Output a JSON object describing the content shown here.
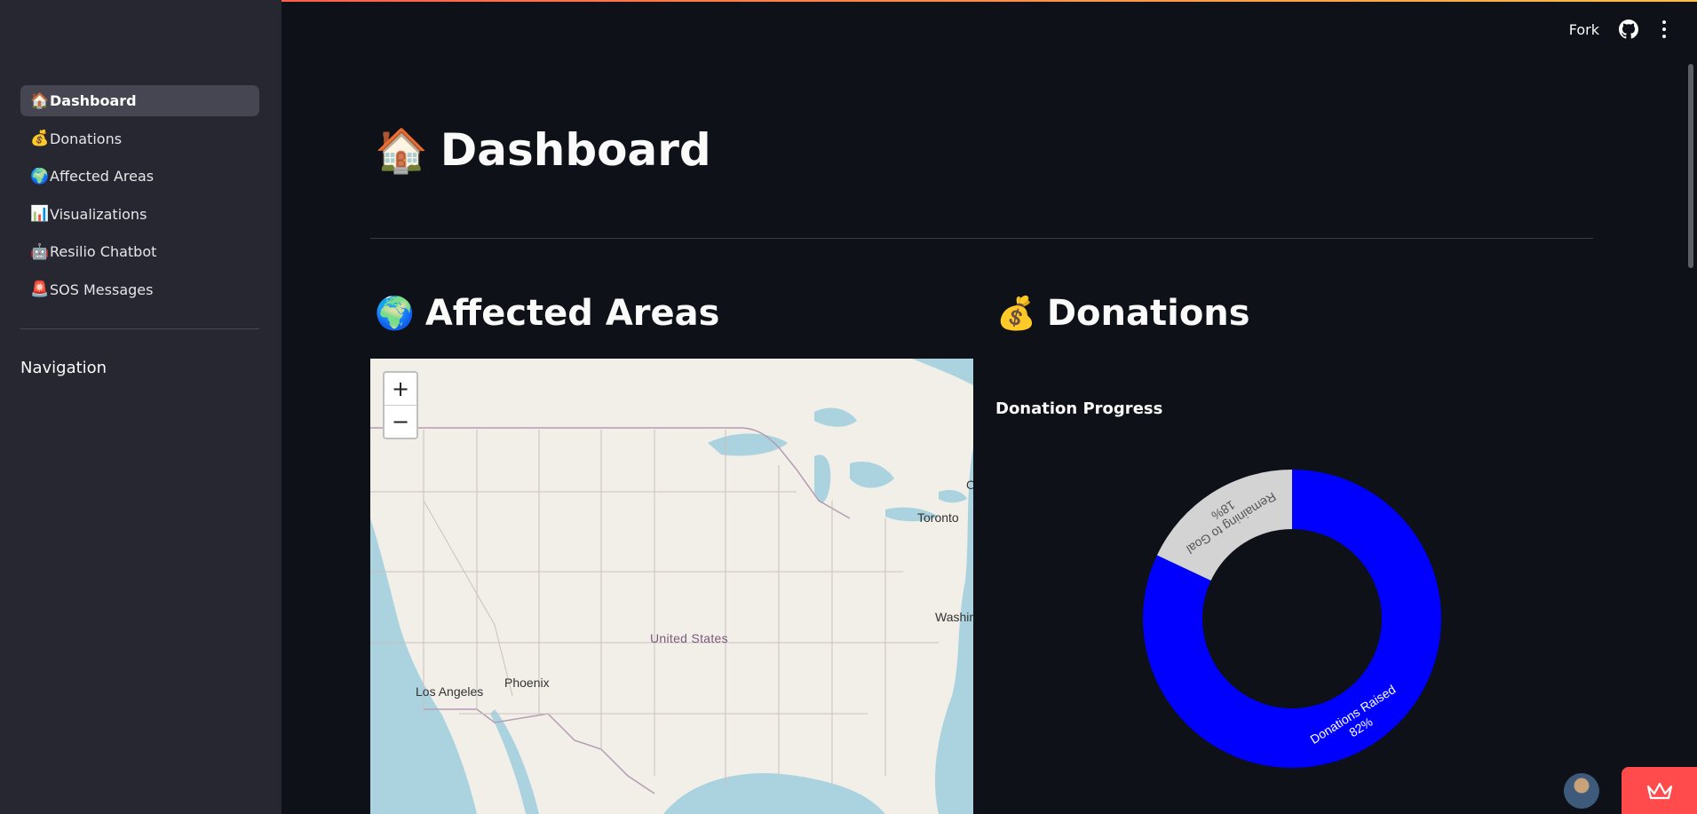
{
  "sidebar": {
    "items": [
      {
        "icon": "🏠",
        "label": "Dashboard"
      },
      {
        "icon": "💰",
        "label": "Donations"
      },
      {
        "icon": "🌍",
        "label": "Affected Areas"
      },
      {
        "icon": "📊",
        "label": "Visualizations"
      },
      {
        "icon": "🤖",
        "label": "Resilio Chatbot"
      },
      {
        "icon": "🚨",
        "label": "SOS Messages"
      }
    ],
    "section_heading": "Navigation"
  },
  "toolbar": {
    "fork_label": "Fork",
    "github_icon": "github-icon",
    "menu_icon": "kebab-menu-icon"
  },
  "page": {
    "title_icon": "🏠",
    "title": "Dashboard"
  },
  "affected_areas": {
    "icon": "🌍",
    "title": "Affected Areas",
    "map": {
      "zoom_in": "+",
      "zoom_out": "−",
      "labels": {
        "toronto": "Toronto",
        "washington": "Washin",
        "country": "United States",
        "phoenix": "Phoenix",
        "los_angeles": "Los Angeles",
        "edge_c": "O"
      }
    }
  },
  "donations": {
    "icon": "💰",
    "title": "Donations",
    "chart_title": "Donation Progress"
  },
  "colors": {
    "raised": "#0000ff",
    "remaining": "#d3d3d3",
    "accent": "#ff4b4b"
  },
  "chart_data": {
    "type": "pie",
    "title": "Donation Progress",
    "categories": [
      "Donations Raised",
      "Remaining to Goal"
    ],
    "values": [
      82,
      18
    ],
    "labels": [
      "82%",
      "18%"
    ],
    "hole": true
  }
}
